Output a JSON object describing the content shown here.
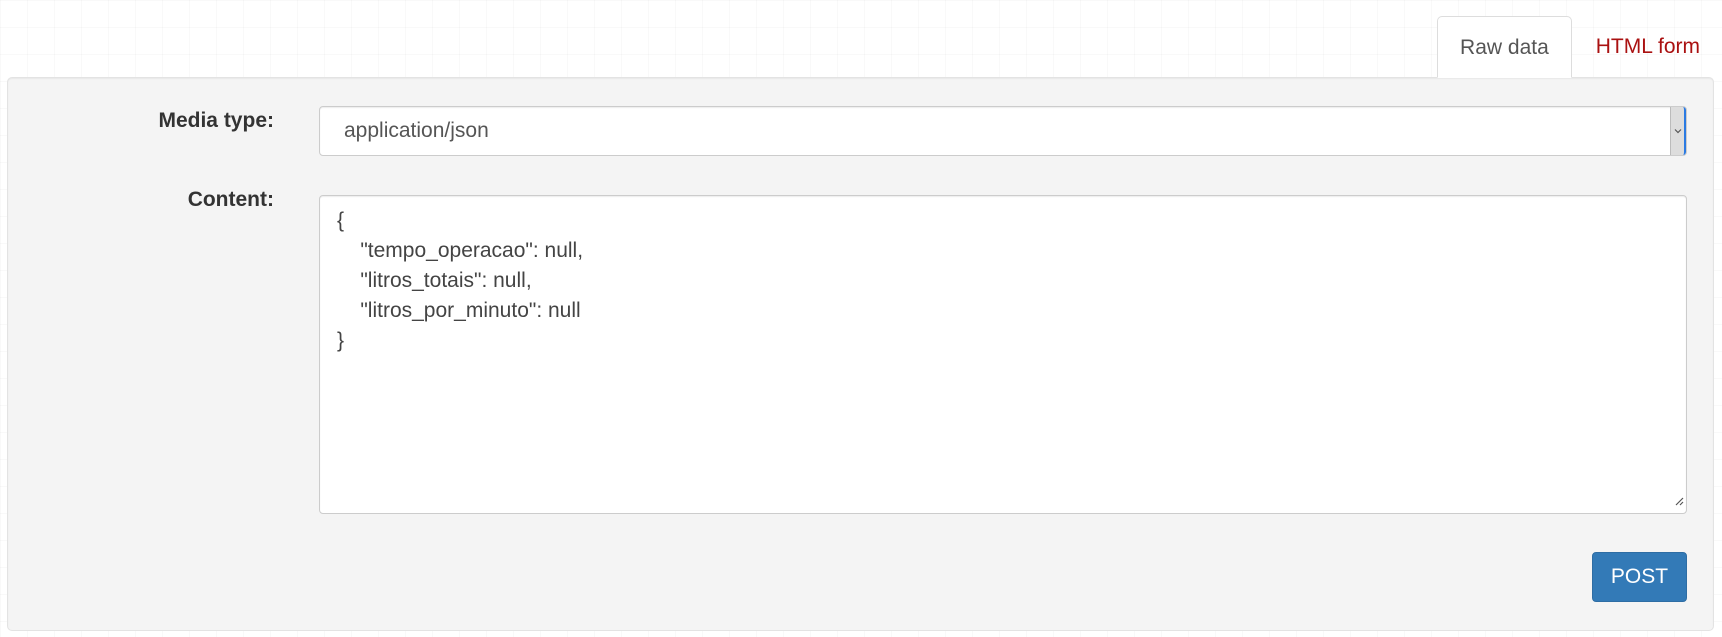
{
  "tabs": [
    {
      "label": "Raw data",
      "active": true
    },
    {
      "label": "HTML form",
      "active": false
    }
  ],
  "form": {
    "media_type_label": "Media type:",
    "media_type_value": "application/json",
    "content_label": "Content:",
    "content_value": "{\n    \"tempo_operacao\": null,\n    \"litros_totais\": null,\n    \"litros_por_minuto\": null\n}",
    "submit_label": "POST"
  },
  "icons": {
    "select_arrow": "chevron-down-icon",
    "resize": "resize-handle-icon"
  },
  "colors": {
    "primary_button": "#337ab7",
    "link_tab": "#aa1111",
    "panel_background": "#f4f4f4"
  }
}
